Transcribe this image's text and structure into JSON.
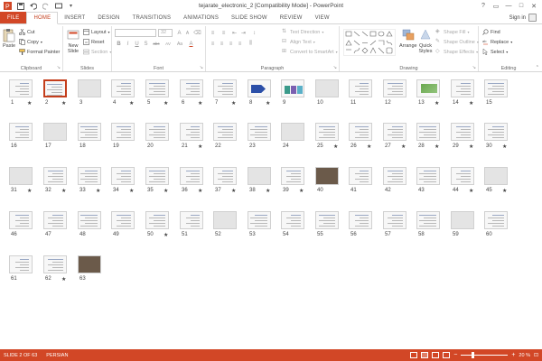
{
  "window": {
    "title": "tejarate_electronic_2 [Compatibility Mode] - PowerPoint",
    "controls": [
      "?",
      "▭",
      "—",
      "□",
      "✕"
    ]
  },
  "qat": [
    "save-icon",
    "undo-icon",
    "redo-icon",
    "present-icon",
    "customize-icon"
  ],
  "tabs": [
    "FILE",
    "HOME",
    "INSERT",
    "DESIGN",
    "TRANSITIONS",
    "ANIMATIONS",
    "SLIDE SHOW",
    "REVIEW",
    "VIEW"
  ],
  "signin": "Sign in",
  "ribbon": {
    "clipboard": {
      "label": "Clipboard",
      "paste": "Paste",
      "cut": "Cut",
      "copy": "Copy",
      "format_painter": "Format Painter"
    },
    "slides": {
      "label": "Slides",
      "new_slide": "New Slide",
      "layout": "Layout",
      "reset": "Reset",
      "section": "Section"
    },
    "font": {
      "label": "Font",
      "size": "32",
      "buttons": [
        "B",
        "I",
        "U",
        "S",
        "abc",
        "AV",
        "Aa",
        "A"
      ]
    },
    "paragraph": {
      "label": "Paragraph",
      "text_direction": "Text Direction",
      "align_text": "Align Text",
      "smartart": "Convert to SmartArt"
    },
    "drawing": {
      "label": "Drawing",
      "arrange": "Arrange",
      "quick_styles": "Quick Styles",
      "shape_fill": "Shape Fill",
      "shape_outline": "Shape Outline",
      "shape_effects": "Shape Effects"
    },
    "editing": {
      "label": "Editing",
      "find": "Find",
      "replace": "Replace",
      "select": "Select"
    }
  },
  "slides": [
    {
      "n": "1",
      "star": "★"
    },
    {
      "n": "2",
      "star": "★"
    },
    {
      "n": "3",
      "star": ""
    },
    {
      "n": "4",
      "star": "★"
    },
    {
      "n": "5",
      "star": "★"
    },
    {
      "n": "6",
      "star": "★"
    },
    {
      "n": "7",
      "star": "★"
    },
    {
      "n": "8",
      "star": "★"
    },
    {
      "n": "9",
      "star": ""
    },
    {
      "n": "10",
      "star": ""
    },
    {
      "n": "11",
      "star": ""
    },
    {
      "n": "12",
      "star": ""
    },
    {
      "n": "13",
      "star": "★"
    },
    {
      "n": "14",
      "star": "★"
    },
    {
      "n": "15",
      "star": ""
    },
    {
      "n": "16",
      "star": ""
    },
    {
      "n": "17",
      "star": ""
    },
    {
      "n": "18",
      "star": ""
    },
    {
      "n": "19",
      "star": ""
    },
    {
      "n": "20",
      "star": ""
    },
    {
      "n": "21",
      "star": "★"
    },
    {
      "n": "22",
      "star": ""
    },
    {
      "n": "23",
      "star": ""
    },
    {
      "n": "24",
      "star": ""
    },
    {
      "n": "25",
      "star": "★"
    },
    {
      "n": "26",
      "star": "★"
    },
    {
      "n": "27",
      "star": "★"
    },
    {
      "n": "28",
      "star": "★"
    },
    {
      "n": "29",
      "star": "★"
    },
    {
      "n": "30",
      "star": "★"
    },
    {
      "n": "31",
      "star": "★"
    },
    {
      "n": "32",
      "star": "★"
    },
    {
      "n": "33",
      "star": "★"
    },
    {
      "n": "34",
      "star": "★"
    },
    {
      "n": "35",
      "star": "★"
    },
    {
      "n": "36",
      "star": "★"
    },
    {
      "n": "37",
      "star": "★"
    },
    {
      "n": "38",
      "star": "★"
    },
    {
      "n": "39",
      "star": "★"
    },
    {
      "n": "40",
      "star": ""
    },
    {
      "n": "41",
      "star": ""
    },
    {
      "n": "42",
      "star": ""
    },
    {
      "n": "43",
      "star": ""
    },
    {
      "n": "44",
      "star": "★"
    },
    {
      "n": "45",
      "star": "★"
    },
    {
      "n": "46",
      "star": ""
    },
    {
      "n": "47",
      "star": ""
    },
    {
      "n": "48",
      "star": ""
    },
    {
      "n": "49",
      "star": ""
    },
    {
      "n": "50",
      "star": "★"
    },
    {
      "n": "51",
      "star": ""
    },
    {
      "n": "52",
      "star": ""
    },
    {
      "n": "53",
      "star": ""
    },
    {
      "n": "54",
      "star": ""
    },
    {
      "n": "55",
      "star": ""
    },
    {
      "n": "56",
      "star": ""
    },
    {
      "n": "57",
      "star": ""
    },
    {
      "n": "58",
      "star": ""
    },
    {
      "n": "59",
      "star": ""
    },
    {
      "n": "60",
      "star": ""
    },
    {
      "n": "61",
      "star": ""
    },
    {
      "n": "62",
      "star": "★"
    },
    {
      "n": "63",
      "star": ""
    }
  ],
  "selected_slide": "2",
  "status": {
    "slide_info": "SLIDE 2 OF 63",
    "language": "PERSIAN",
    "zoom": "20 %",
    "zoom_minus": "−",
    "zoom_plus": "+"
  },
  "colors": {
    "accent": "#d24726",
    "selected": "#c43e1c"
  }
}
